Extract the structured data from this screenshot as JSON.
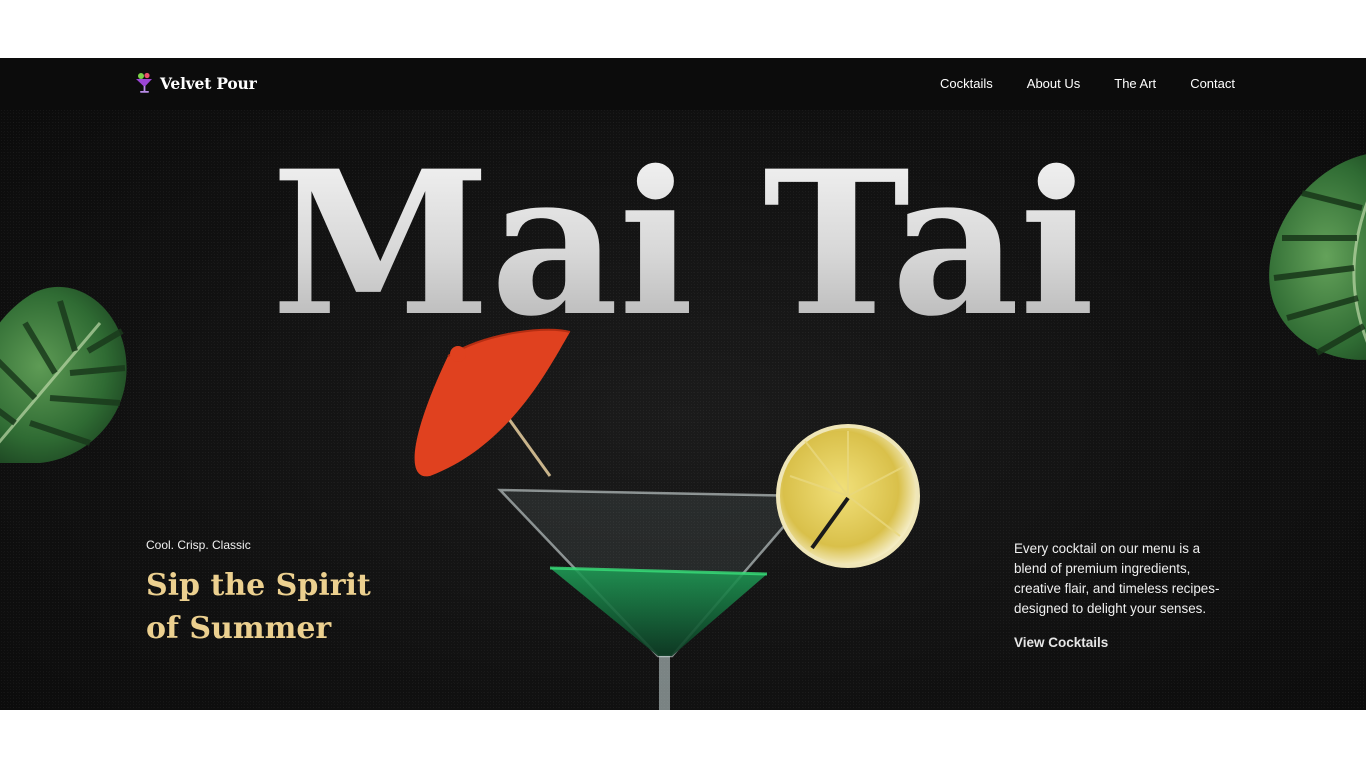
{
  "brand": {
    "name": "Velvet Pour",
    "logo_icon": "cocktail-glass-icon"
  },
  "nav": {
    "items": [
      {
        "label": "Cocktails"
      },
      {
        "label": "About Us"
      },
      {
        "label": "The Art"
      },
      {
        "label": "Contact"
      }
    ]
  },
  "hero": {
    "title": "Mai Tai",
    "tagline_small": "Cool. Crisp. Classic",
    "tagline_big": "Sip the Spirit of Summer",
    "description": "Every cocktail on our menu is a blend of premium ingredients, creative flair, and timeless recipes-designed to delight your senses.",
    "cta_label": "View Cocktails",
    "images": [
      "monstera-leaf-left",
      "monstera-leaf-right",
      "martini-glass-with-umbrella-and-lemon"
    ]
  },
  "colors": {
    "background": "#121212",
    "accent_gold": "#ecd08f",
    "text_light": "#ffffff"
  }
}
